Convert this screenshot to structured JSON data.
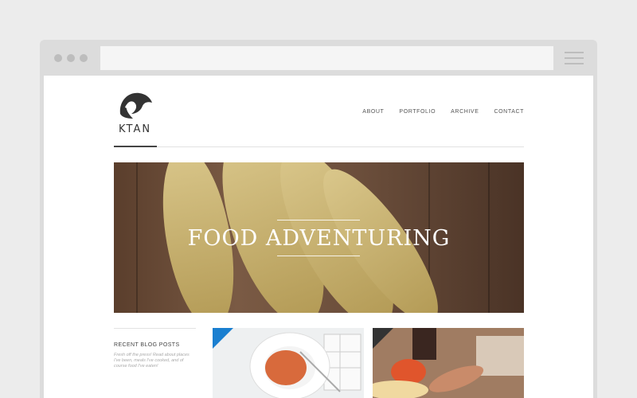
{
  "logo": {
    "text": "KTAN"
  },
  "nav": [
    "ABOUT",
    "PORTFOLIO",
    "ARCHIVE",
    "CONTACT"
  ],
  "hero": {
    "title": "FOOD ADVENTURING"
  },
  "sidebar": {
    "heading": "RECENT BLOG POSTS",
    "blurb": "Fresh off the press! Read about places I've been, meals I've cooked, and of course food I've eaten!"
  },
  "colors": {
    "accent": "#1a7fd0",
    "dark_corner": "#333333"
  },
  "icons": [
    "window-dot-icon",
    "hamburger-menu-icon",
    "ktan-logo-icon"
  ]
}
